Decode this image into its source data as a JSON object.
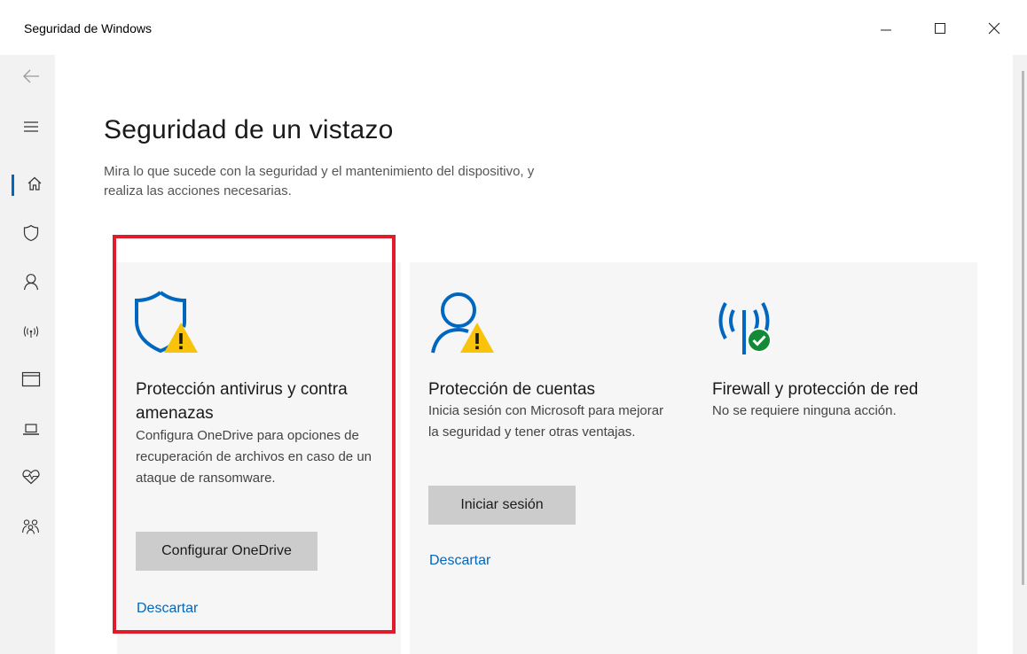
{
  "window": {
    "title": "Seguridad de Windows",
    "controls": [
      "minimize-icon",
      "maximize-icon",
      "close-icon"
    ]
  },
  "sidebar": {
    "items": [
      {
        "icon": "back-arrow-icon"
      },
      {
        "icon": "hamburger-menu-icon"
      },
      {
        "icon": "home-icon",
        "active": true
      },
      {
        "icon": "shield-icon"
      },
      {
        "icon": "person-icon"
      },
      {
        "icon": "wireless-signal-icon"
      },
      {
        "icon": "app-browser-window-icon"
      },
      {
        "icon": "laptop-icon"
      },
      {
        "icon": "heart-pulse-icon"
      },
      {
        "icon": "family-icon"
      }
    ]
  },
  "main": {
    "title": "Seguridad de un vistazo",
    "description": "Mira lo que sucede con la seguridad y el mantenimiento del dispositivo, y realiza las acciones necesarias.",
    "cards": [
      {
        "icon": "shield-warning-icon",
        "title": "Protección antivirus y contra amenazas",
        "description": "Configura OneDrive para opciones de recuperación de archivos en caso de un ataque de ransomware.",
        "button": "Configurar OneDrive",
        "link": "Descartar",
        "highlighted": true
      },
      {
        "icon": "person-warning-icon",
        "title": "Protección de cuentas",
        "description": "Inicia sesión con Microsoft para mejorar la seguridad y tener otras ventajas.",
        "button": "Iniciar sesión",
        "link": "Descartar"
      },
      {
        "icon": "wireless-check-icon",
        "title": "Firewall y protección de red",
        "description": "No se requiere ninguna acción."
      }
    ]
  },
  "colors": {
    "accent": "#0067c0",
    "warning": "#f9c20b",
    "ok": "#138a36",
    "highlight": "#e01c2b",
    "button_bg": "#cccccc"
  }
}
